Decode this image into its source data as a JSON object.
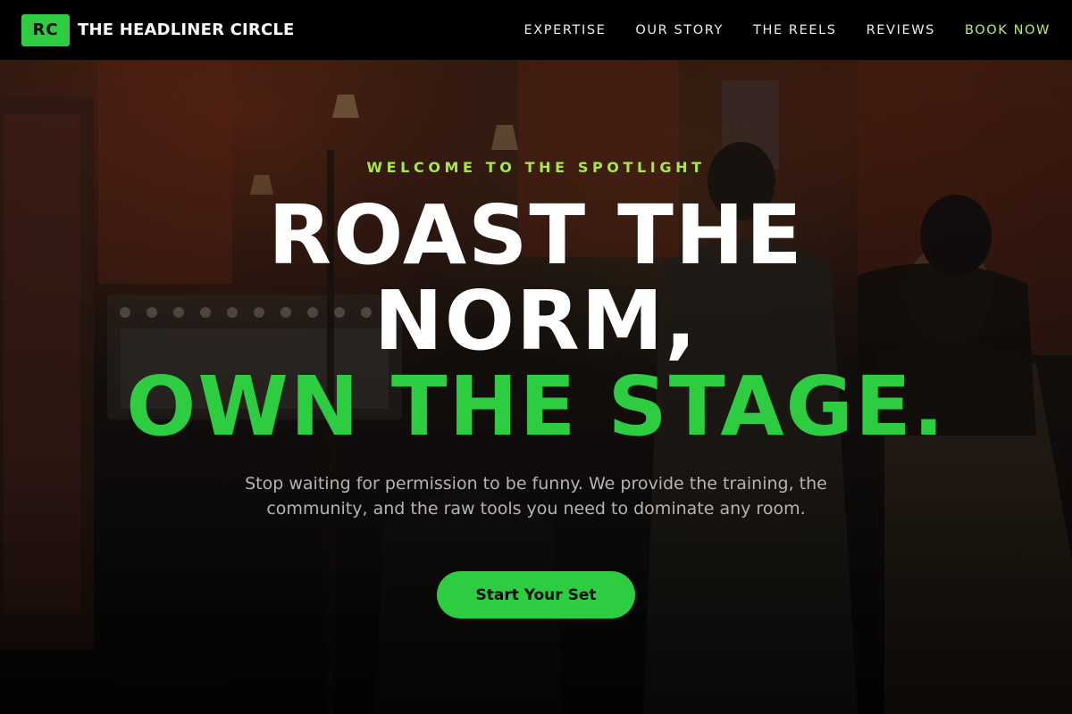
{
  "brand": {
    "badge": "RC",
    "name": "THE HEADLINER CIRCLE"
  },
  "nav": {
    "items": [
      {
        "label": "EXPERTISE"
      },
      {
        "label": "OUR STORY"
      },
      {
        "label": "THE REELS"
      },
      {
        "label": "REVIEWS"
      },
      {
        "label": "BOOK NOW"
      }
    ]
  },
  "hero": {
    "eyebrow": "WELCOME TO THE SPOTLIGHT",
    "headline": {
      "line1": "ROAST THE",
      "line2": "NORM,",
      "line3": "OWN THE STAGE."
    },
    "subtitle": "Stop waiting for permission to be funny. We provide the training, the community, and the raw tools you need to dominate any room.",
    "cta_label": "Start Your Set"
  },
  "colors": {
    "accent_green": "#2ecc40",
    "eyebrow_lime": "#a6e84a",
    "book_now_lime": "#b5ef6a",
    "nav_background": "#000000"
  }
}
